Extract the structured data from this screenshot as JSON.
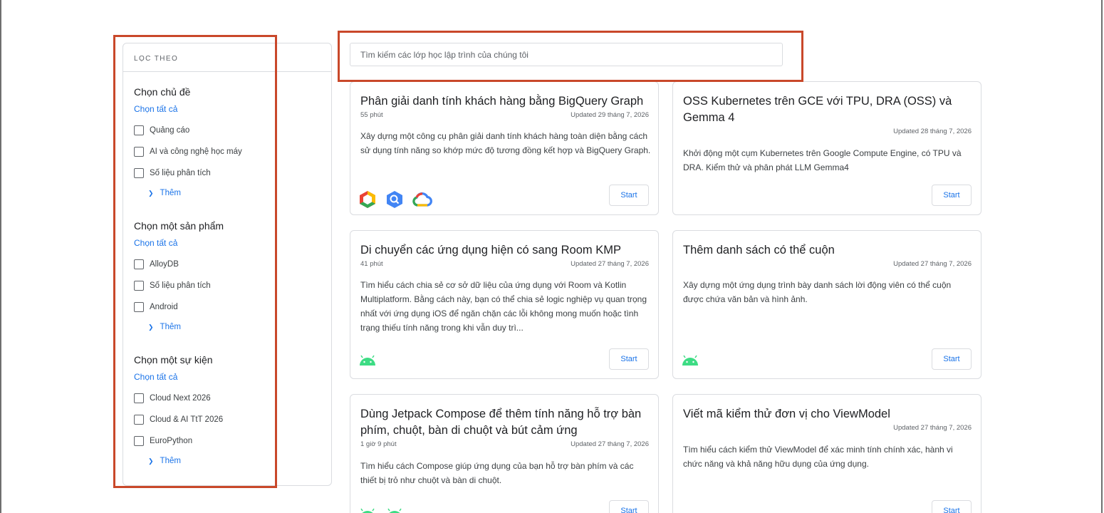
{
  "sidebar": {
    "header": "LỌC THEO",
    "groups": [
      {
        "title": "Chọn chủ đề",
        "select_all": "Chọn tất cả",
        "options": [
          "Quảng cáo",
          "AI và công nghệ học máy",
          "Số liệu phân tích"
        ],
        "more": "Thêm"
      },
      {
        "title": "Chọn một sản phẩm",
        "select_all": "Chọn tất cả",
        "options": [
          "AlloyDB",
          "Số liệu phân tích",
          "Android"
        ],
        "more": "Thêm"
      },
      {
        "title": "Chọn một sự kiện",
        "select_all": "Chọn tất cả",
        "options": [
          "Cloud Next 2026",
          "Cloud & AI TtT 2026",
          "EuroPython"
        ],
        "more": "Thêm"
      }
    ]
  },
  "search": {
    "placeholder": "Tìm kiếm các lớp học lập trình của chúng tôi"
  },
  "cards": [
    {
      "title": "Phân giải danh tính khách hàng bằng BigQuery Graph",
      "duration": "55 phút",
      "updated": "Updated 29 tháng 7, 2026",
      "description": "Xây dựng một công cụ phân giải danh tính khách hàng toàn diện bằng cách sử dụng tính năng so khớp mức độ tương đồng kết hợp và BigQuery Graph.",
      "icons": [
        "google-cloud-hexagon-icon",
        "bigquery-icon",
        "google-cloud-icon"
      ],
      "start": "Start"
    },
    {
      "title": "OSS Kubernetes trên GCE với TPU, DRA (OSS) và Gemma 4",
      "duration": "",
      "updated": "Updated 28 tháng 7, 2026",
      "description": "Khởi động một cụm Kubernetes trên Google Compute Engine, có TPU và DRA. Kiểm thử và phân phát LLM Gemma4",
      "icons": [],
      "start": "Start"
    },
    {
      "title": "Di chuyển các ứng dụng hiện có sang Room KMP",
      "duration": "41 phút",
      "updated": "Updated 27 tháng 7, 2026",
      "description": "Tìm hiểu cách chia sẻ cơ sở dữ liệu của ứng dụng với Room và Kotlin Multiplatform. Bằng cách này, bạn có thể chia sẻ logic nghiệp vụ quan trọng nhất với ứng dụng iOS để ngăn chặn các lỗi không mong muốn hoặc tình trạng thiếu tính năng trong khi vẫn duy trì...",
      "icons": [
        "android-icon"
      ],
      "start": "Start"
    },
    {
      "title": "Thêm danh sách có thể cuộn",
      "duration": "",
      "updated": "Updated 27 tháng 7, 2026",
      "description": "Xây dựng một ứng dụng trình bày danh sách lời động viên có thể cuộn được chứa văn bản và hình ảnh.",
      "icons": [
        "android-icon"
      ],
      "start": "Start"
    },
    {
      "title": "Dùng Jetpack Compose để thêm tính năng hỗ trợ bàn phím, chuột, bàn di chuột và bút cảm ứng",
      "duration": "1 giờ 9 phút",
      "updated": "Updated 27 tháng 7, 2026",
      "description": "Tìm hiểu cách Compose giúp ứng dụng của bạn hỗ trợ bàn phím và các thiết bị trỏ như chuột và bàn di chuột.",
      "icons": [
        "android-icon",
        "android-icon"
      ],
      "start": "Start"
    },
    {
      "title": "Viết mã kiểm thử đơn vị cho ViewModel",
      "duration": "",
      "updated": "Updated 27 tháng 7, 2026",
      "description": "Tìm hiểu cách kiểm thử ViewModel để xác minh tính chính xác, hành vi chức năng và khả năng hữu dụng của ứng dụng.",
      "icons": [],
      "start": "Start"
    }
  ],
  "colors": {
    "accent": "#1a73e8",
    "highlight": "#c9482a",
    "android": "#3ddc84"
  }
}
